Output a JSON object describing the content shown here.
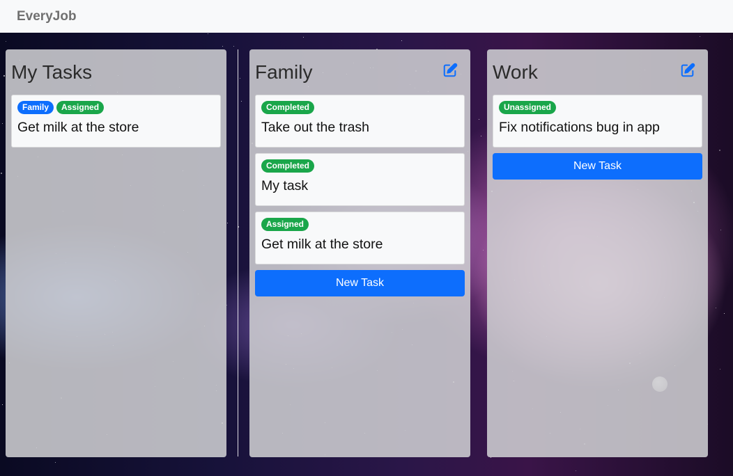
{
  "navbar": {
    "brand": "EveryJob"
  },
  "columns": {
    "my_tasks": {
      "title": "My Tasks",
      "cards": [
        {
          "badges": [
            "Family",
            "Assigned"
          ],
          "title": "Get milk at the store"
        }
      ]
    },
    "family": {
      "title": "Family",
      "cards": [
        {
          "badges": [
            "Completed"
          ],
          "title": "Take out the trash"
        },
        {
          "badges": [
            "Completed"
          ],
          "title": "My task"
        },
        {
          "badges": [
            "Assigned"
          ],
          "title": "Get milk at the store"
        }
      ],
      "new_task_label": "New Task"
    },
    "work": {
      "title": "Work",
      "cards": [
        {
          "badges": [
            "Unassigned"
          ],
          "title": "Fix notifications bug in app"
        }
      ],
      "new_task_label": "New Task"
    }
  },
  "icons": {
    "edit": "edit-icon"
  },
  "colors": {
    "primary": "#0d6efd",
    "success": "#1aa64a",
    "navbar": "#f8f9fa"
  }
}
